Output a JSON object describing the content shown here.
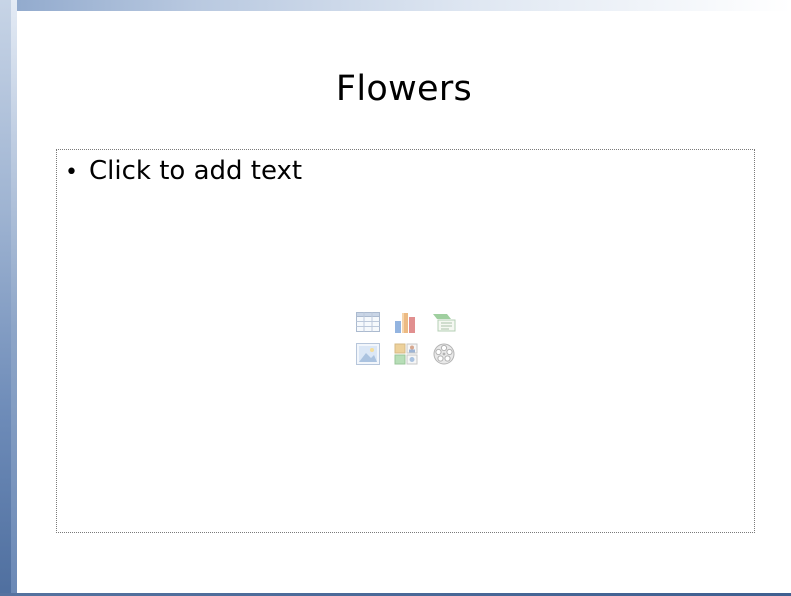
{
  "slide": {
    "title": "Flowers",
    "content_placeholder": {
      "bullet": "•",
      "prompt_text": "Click to add text"
    },
    "insert_icons": [
      {
        "icon": "insert-table-icon"
      },
      {
        "icon": "insert-chart-icon"
      },
      {
        "icon": "insert-smartart-icon"
      },
      {
        "icon": "insert-picture-icon"
      },
      {
        "icon": "insert-clipart-icon"
      },
      {
        "icon": "insert-media-icon"
      }
    ]
  },
  "colors": {
    "frame_blue": "#4f6f9f",
    "frame_light": "#c7d4e6",
    "placeholder_border": "#7a7a7a"
  }
}
